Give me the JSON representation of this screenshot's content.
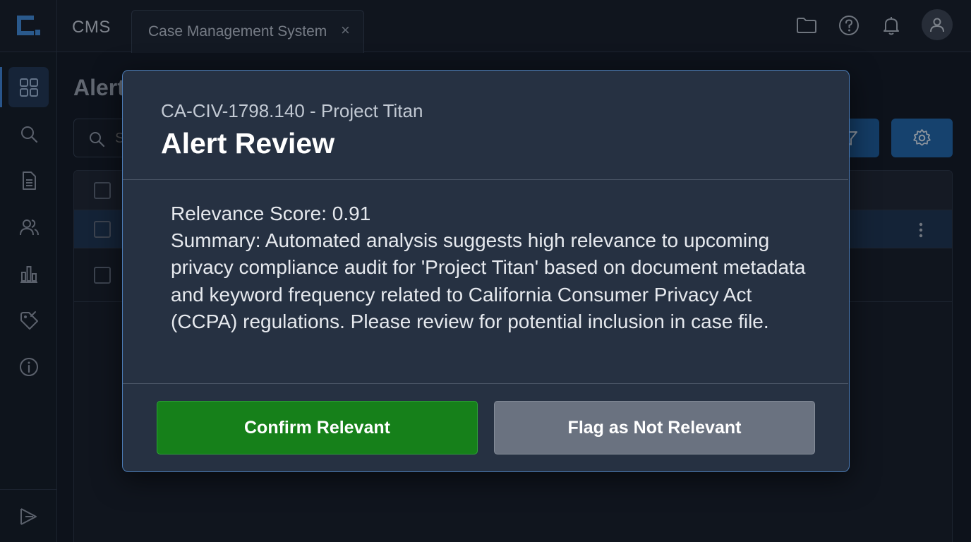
{
  "app": {
    "name": "CMS",
    "logo_icon": "cms-logo-icon"
  },
  "tabs": [
    {
      "label": "Case Management System",
      "close": "×"
    }
  ],
  "header_icons": [
    "folder-icon",
    "help-icon",
    "bell-icon",
    "user-icon"
  ],
  "sidebar": {
    "items": [
      {
        "icon": "dashboard-icon",
        "active": true
      },
      {
        "icon": "search-icon",
        "active": false
      },
      {
        "icon": "document-icon",
        "active": false
      },
      {
        "icon": "users-icon",
        "active": false
      },
      {
        "icon": "chart-icon",
        "active": false
      },
      {
        "icon": "tag-icon",
        "active": false
      },
      {
        "icon": "info-icon",
        "active": false
      }
    ],
    "footer_icon": "expand-sidebar-icon"
  },
  "page": {
    "title": "Alert",
    "search_placeholder": "S"
  },
  "modal": {
    "subtitle": "CA-CIV-1798.140 - Project Titan",
    "title": "Alert Review",
    "relevance_line": "Relevance Score: 0.91",
    "summary": "Summary: Automated analysis suggests high relevance to upcoming privacy compliance audit for 'Project Titan' based on document metadata and keyword frequency related to California Consumer Privacy Act (CCPA) regulations. Please review for potential inclusion in case file.",
    "confirm_label": "Confirm Relevant",
    "flag_label": "Flag as Not Relevant"
  },
  "colors": {
    "confirm": "#16801a",
    "flag": "#6a7280",
    "accent": "#1f64a8",
    "modal_border": "#4b7bb5"
  }
}
